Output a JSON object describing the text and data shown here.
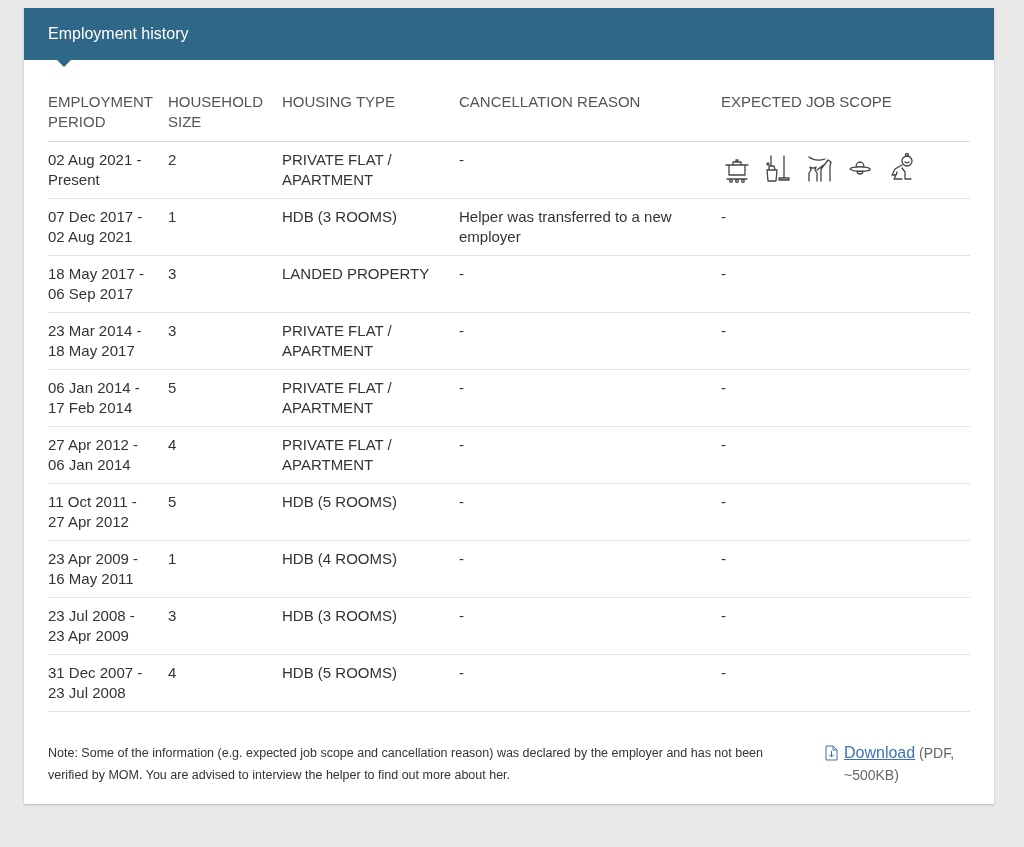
{
  "panel": {
    "title": "Employment history"
  },
  "table": {
    "columns": [
      "EMPLOYMENT PERIOD",
      "HOUSEHOLD SIZE",
      "HOUSING TYPE",
      "CANCELLATION REASON",
      "EXPECTED JOB SCOPE"
    ],
    "rows": [
      {
        "period": "02 Aug 2021 - Present",
        "household_size": "2",
        "housing_type": "PRIVATE FLAT / APARTMENT",
        "cancellation_reason": "-",
        "kind": "icons"
      },
      {
        "period": "07 Dec 2017 - 02 Aug 2021",
        "household_size": "1",
        "housing_type": "HDB (3 ROOMS)",
        "cancellation_reason": "Helper was transferred to a new employer",
        "kind": "text",
        "job_scope": "-"
      },
      {
        "period": "18 May 2017 - 06 Sep 2017",
        "household_size": "3",
        "housing_type": "LANDED PROPERTY",
        "cancellation_reason": "-",
        "kind": "text",
        "job_scope": "-"
      },
      {
        "period": "23 Mar 2014 - 18 May 2017",
        "household_size": "3",
        "housing_type": "PRIVATE FLAT / APARTMENT",
        "cancellation_reason": "-",
        "kind": "text",
        "job_scope": "-"
      },
      {
        "period": "06 Jan 2014 - 17 Feb 2014",
        "household_size": "5",
        "housing_type": "PRIVATE FLAT / APARTMENT",
        "cancellation_reason": "-",
        "kind": "text",
        "job_scope": "-"
      },
      {
        "period": "27 Apr 2012 - 06 Jan 2014",
        "household_size": "4",
        "housing_type": "PRIVATE FLAT / APARTMENT",
        "cancellation_reason": "-",
        "kind": "text",
        "job_scope": "-"
      },
      {
        "period": "11 Oct 2011 - 27 Apr 2012",
        "household_size": "5",
        "housing_type": "HDB (5 ROOMS)",
        "cancellation_reason": "-",
        "kind": "text",
        "job_scope": "-"
      },
      {
        "period": "23 Apr 2009 - 16 May 2011",
        "household_size": "1",
        "housing_type": "HDB (4 ROOMS)",
        "cancellation_reason": "-",
        "kind": "text",
        "job_scope": "-"
      },
      {
        "period": "23 Jul 2008 - 23 Apr 2009",
        "household_size": "3",
        "housing_type": "HDB (3 ROOMS)",
        "cancellation_reason": "-",
        "kind": "text",
        "job_scope": "-"
      },
      {
        "period": "31 Dec 2007 - 23 Jul 2008",
        "household_size": "4",
        "housing_type": "HDB (5 ROOMS)",
        "cancellation_reason": "-",
        "kind": "text",
        "job_scope": "-"
      }
    ]
  },
  "footer": {
    "note": "Note: Some of the information (e.g. expected job scope and cancellation reason) was declared by the employer and has not been verified by MOM. You are advised to interview the helper to find out more about her.",
    "download_label": "Download",
    "download_info": "(PDF, ~500KB)"
  }
}
